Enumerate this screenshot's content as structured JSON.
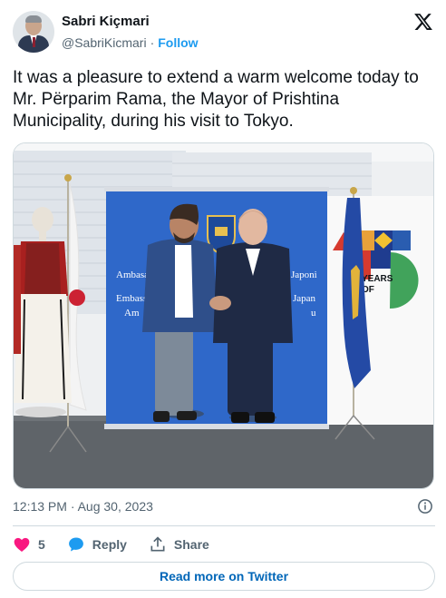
{
  "header": {
    "display_name": "Sabri Kiçmari",
    "handle": "@SabriKicmari",
    "separator": "·",
    "follow_label": "Follow"
  },
  "tweet": {
    "text": "It was a pleasure to extend a warm welcome today to Mr. Përparim Rama, the Mayor of Prishtina Municipality, during his visit to Tokyo."
  },
  "photo": {
    "banner_text": {
      "line1_left": "Ambasa",
      "line1_right": "Japoni",
      "line2_left": "Embass",
      "line2_right": "Japan",
      "line3_left": "Am",
      "line3_right": "u"
    },
    "poster_text": {
      "years": "YEARS",
      "of": "OF"
    }
  },
  "meta": {
    "timestamp": "12:13 PM · Aug 30, 2023"
  },
  "actions": {
    "like_count": "5",
    "reply_label": "Reply",
    "share_label": "Share"
  },
  "footer": {
    "read_more_label": "Read more on Twitter"
  },
  "colors": {
    "accent": "#1d9bf0",
    "link": "#0066b8",
    "like": "#f91880",
    "muted": "#536471",
    "border": "#cfd9de"
  },
  "icons": [
    "x-logo-icon",
    "info-icon",
    "heart-icon",
    "reply-bubble-icon",
    "share-icon"
  ]
}
